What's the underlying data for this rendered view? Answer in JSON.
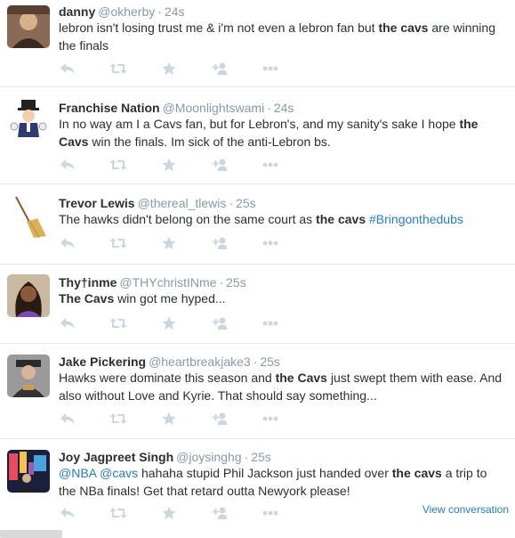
{
  "tweets": [
    {
      "fullname": "danny",
      "username": "@okherby",
      "time": "24s",
      "text": [
        {
          "t": "lebron isn't losing trust me & i'm not even a lebron fan but "
        },
        {
          "t": "the cavs",
          "style": "bold"
        },
        {
          "t": " are winning the finals"
        }
      ]
    },
    {
      "fullname": "Franchise Nation",
      "username": "@Moonlightswami",
      "time": "24s",
      "text": [
        {
          "t": "In no way am I a Cavs fan, but for Lebron's, and my sanity's sake I hope "
        },
        {
          "t": "the Cavs",
          "style": "bold"
        },
        {
          "t": " win the finals. Im sick of the anti-Lebron bs."
        }
      ]
    },
    {
      "fullname": "Trevor Lewis",
      "username": "@thereal_tlewis",
      "time": "25s",
      "text": [
        {
          "t": "The hawks didn't belong on the same court as "
        },
        {
          "t": "the cavs",
          "style": "bold"
        },
        {
          "t": " "
        },
        {
          "t": "#Bringonthedubs",
          "style": "link"
        }
      ]
    },
    {
      "fullname": "Thy†inme",
      "username": "@THYchristINme",
      "time": "25s",
      "text": [
        {
          "t": "The Cavs",
          "style": "bold"
        },
        {
          "t": " win got me hyped..."
        }
      ]
    },
    {
      "fullname": "Jake Pickering",
      "username": "@heartbreakjake3",
      "time": "25s",
      "text": [
        {
          "t": "Hawks were dominate this season and "
        },
        {
          "t": "the Cavs",
          "style": "bold"
        },
        {
          "t": " just swept them with ease. And also without Love and Kyrie. That should say something..."
        }
      ]
    },
    {
      "fullname": "Joy Jagpreet Singh",
      "username": "@joysinghg",
      "time": "25s",
      "text": [
        {
          "t": "@NBA",
          "style": "link"
        },
        {
          "t": " "
        },
        {
          "t": "@cavs",
          "style": "link"
        },
        {
          "t": " hahaha stupid Phil Jackson just handed over "
        },
        {
          "t": "the cavs",
          "style": "bold"
        },
        {
          "t": " a trip to the NBa finals! Get that retard outta Newyork please!"
        }
      ],
      "view_conversation": "View conversation"
    }
  ],
  "actions": [
    "reply-icon",
    "retweet-icon",
    "favorite-icon",
    "follow-icon",
    "more-icon"
  ],
  "colors": {
    "action_icon": "#ccd6dd",
    "link": "#2b7bb9",
    "secondary": "#8899a6",
    "divider": "#e1e8ed"
  }
}
